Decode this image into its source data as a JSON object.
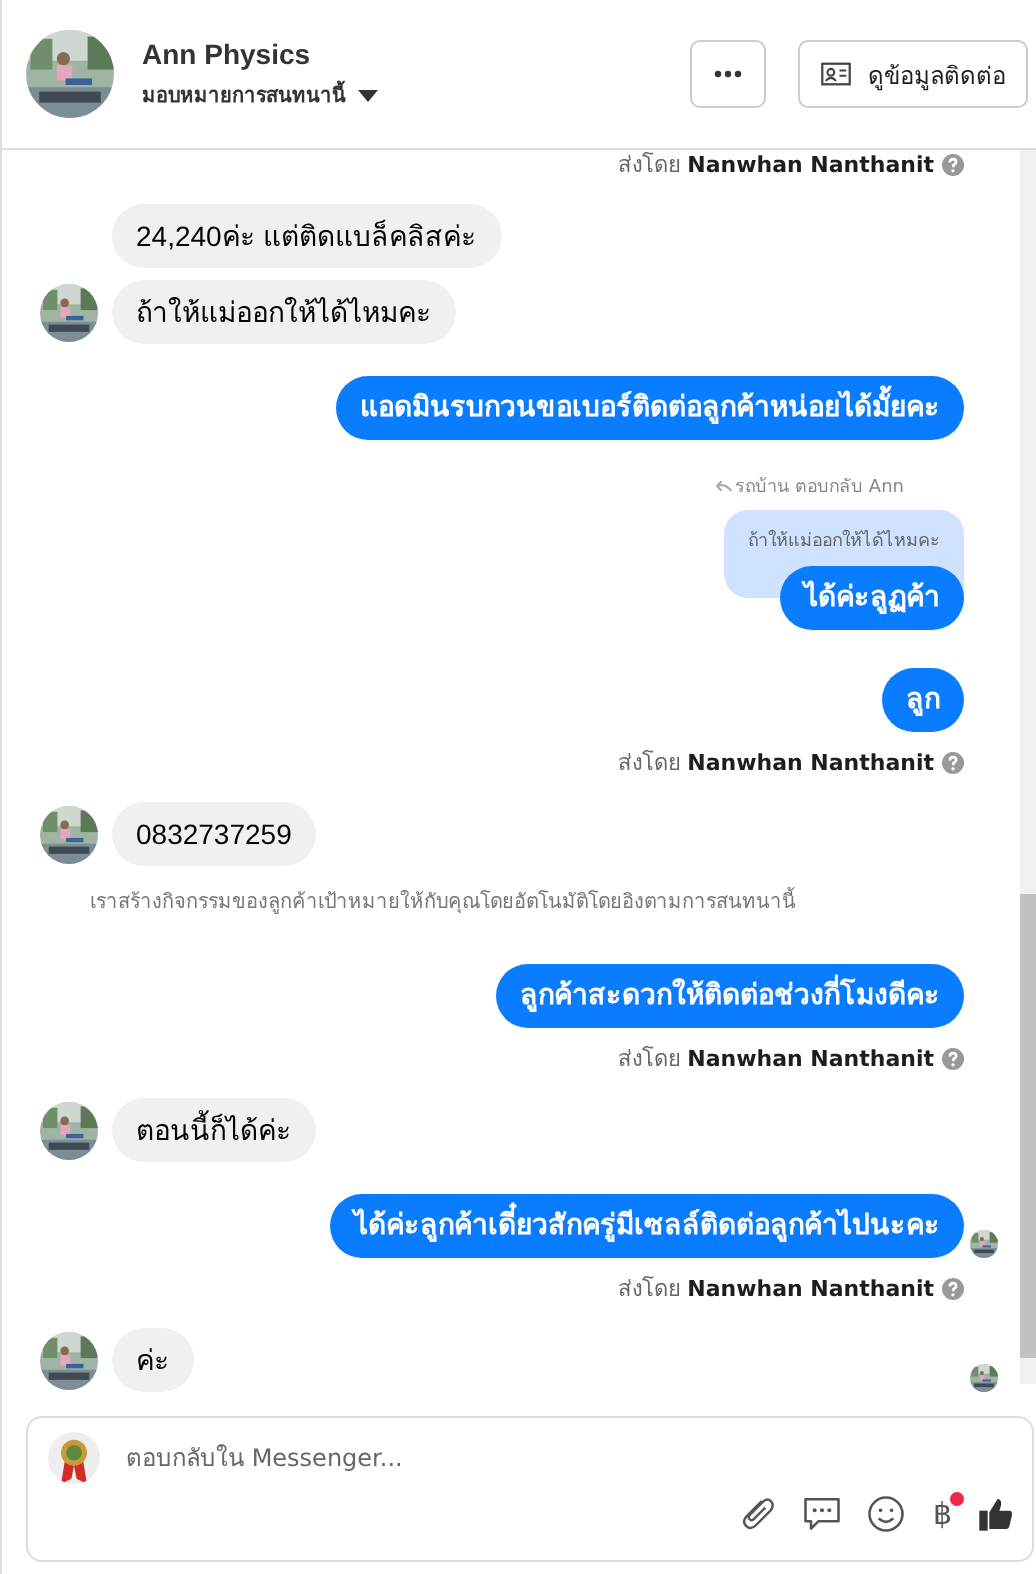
{
  "header": {
    "name": "Ann Physics",
    "subtitle": "มอบหมายการสนทนานี้",
    "contact_button": "ดูข้อมูลติดต่อ"
  },
  "messages": [
    {
      "kind": "sent_by",
      "prefix": "ส่งโดย",
      "name": "Nanwhan Nanthanit"
    },
    {
      "kind": "incoming",
      "text": "24,240ค่ะ  แต่ติดแบล็คลิสค่ะ",
      "avatar": false
    },
    {
      "kind": "incoming",
      "text": "ถ้าให้แม่ออกให้ได้ไหมคะ",
      "avatar": true
    },
    {
      "kind": "outgoing",
      "text": "แอดมินรบกวนขอเบอร์ติดต่อลูกค้าหน่อยได้มั้ยคะ",
      "seen": false
    },
    {
      "kind": "reply",
      "label": "รถบ้าน ตอบกลับ Ann",
      "quote": "ถ้าให้แม่ออกให้ได้ไหมคะ",
      "text": "ได้ค่ะลูฏค้า"
    },
    {
      "kind": "outgoing",
      "text": "ลูก",
      "seen": false
    },
    {
      "kind": "sent_by",
      "prefix": "ส่งโดย",
      "name": "Nanwhan Nanthanit"
    },
    {
      "kind": "incoming",
      "text": "0832737259",
      "avatar": true
    },
    {
      "kind": "note",
      "text": "เราสร้างกิจกรรมของลูกค้าเป้าหมายให้กับคุณโดยอัตโนมัติโดยอิงตามการสนทนานี้"
    },
    {
      "kind": "outgoing",
      "text": "ลูกค้าสะดวกให้ติดต่อช่วงกี่โมงดีคะ",
      "seen": false
    },
    {
      "kind": "sent_by",
      "prefix": "ส่งโดย",
      "name": "Nanwhan Nanthanit"
    },
    {
      "kind": "incoming",
      "text": "ตอนนี้ก็ได้ค่ะ",
      "avatar": true
    },
    {
      "kind": "outgoing",
      "text": "ได้ค่ะลูกค้าเดี๋ยวสักครู่มีเซลล์ติดต่อลูกค้าไปนะคะ",
      "seen": true
    },
    {
      "kind": "sent_by",
      "prefix": "ส่งโดย",
      "name": "Nanwhan Nanthanit"
    },
    {
      "kind": "incoming",
      "text": "ค่ะ",
      "avatar": true,
      "seen": true
    }
  ],
  "composer": {
    "placeholder": "ตอบกลับใน Messenger...",
    "currency": "฿",
    "currency_badge": true
  }
}
